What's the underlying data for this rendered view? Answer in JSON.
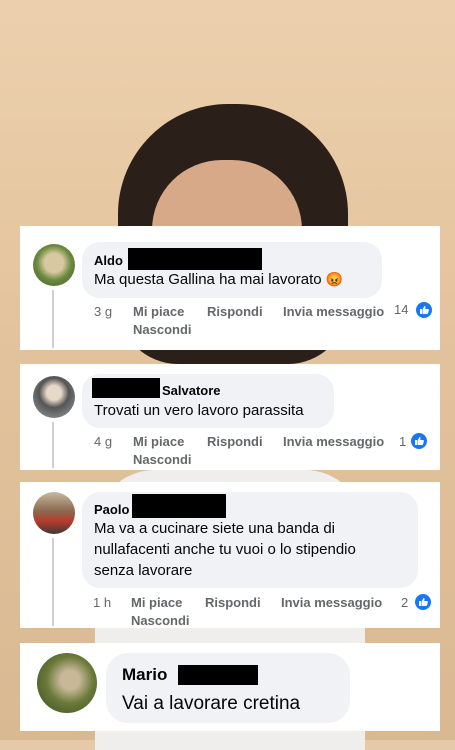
{
  "comments": [
    {
      "name": "Aldo",
      "text": "Ma questa Gallina ha mai lavorato",
      "emoji": "😡",
      "time": "3 g",
      "like_label": "Mi piace",
      "reply_label": "Rispondi",
      "message_label": "Invia messaggio",
      "hide_label": "Nascondi",
      "reactions": "14"
    },
    {
      "name": "Salvatore",
      "text": "Trovati un vero lavoro parassita",
      "time": "4 g",
      "like_label": "Mi piace",
      "reply_label": "Rispondi",
      "message_label": "Invia messaggio",
      "hide_label": "Nascondi",
      "reactions": "1"
    },
    {
      "name": "Paolo",
      "text_lines": [
        "Ma va a cucinare  siete una banda di",
        "nullafacenti anche tu vuoi o lo stipendio",
        "senza lavorare"
      ],
      "time": "1 h",
      "like_label": "Mi piace",
      "reply_label": "Rispondi",
      "message_label": "Invia messaggio",
      "hide_label": "Nascondi",
      "reactions": "2"
    },
    {
      "name": "Mario",
      "text": "Vai a lavorare cretina"
    }
  ],
  "colors": {
    "like_blue": "#1877f2",
    "bubble": "#f0f2f5",
    "meta_text": "#65676b"
  },
  "icons": [
    "like-thumb-icon",
    "angry-face-emoji"
  ]
}
